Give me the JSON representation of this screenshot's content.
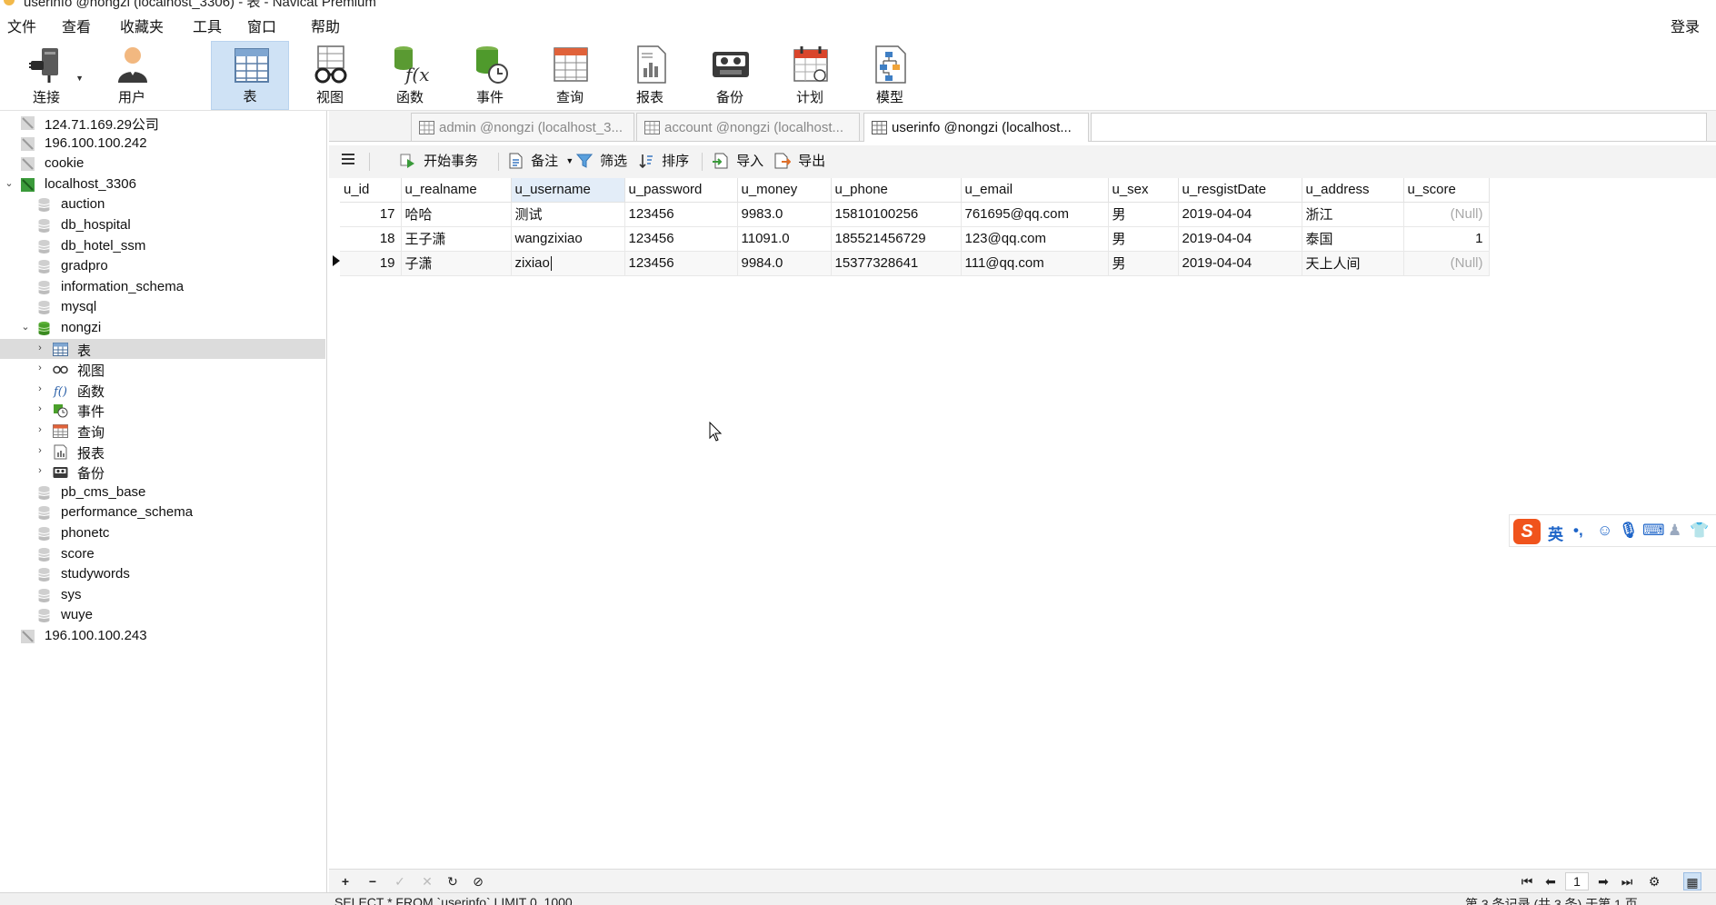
{
  "window": {
    "title": "userinfo @nongzi (localhost_3306) - 表 - Navicat Premium"
  },
  "menubar": {
    "items": [
      "文件",
      "查看",
      "收藏夹",
      "工具",
      "窗口",
      "帮助"
    ],
    "login": "登录"
  },
  "toolbar": {
    "connect": "连接",
    "user": "用户",
    "table": "表",
    "view": "视图",
    "function": "函数",
    "event": "事件",
    "query": "查询",
    "report": "报表",
    "backup": "备份",
    "schedule": "计划",
    "model": "模型"
  },
  "tree": {
    "items": [
      {
        "label": "124.71.169.29公司",
        "level": 0,
        "type": "server-off"
      },
      {
        "label": "196.100.100.242",
        "level": 0,
        "type": "server-off"
      },
      {
        "label": "cookie",
        "level": 0,
        "type": "server-off"
      },
      {
        "label": "localhost_3306",
        "level": 0,
        "type": "server-on",
        "expanded": true
      },
      {
        "label": "auction",
        "level": 1,
        "type": "db"
      },
      {
        "label": "db_hospital",
        "level": 1,
        "type": "db"
      },
      {
        "label": "db_hotel_ssm",
        "level": 1,
        "type": "db"
      },
      {
        "label": "gradpro",
        "level": 1,
        "type": "db"
      },
      {
        "label": "information_schema",
        "level": 1,
        "type": "db"
      },
      {
        "label": "mysql",
        "level": 1,
        "type": "db"
      },
      {
        "label": "nongzi",
        "level": 1,
        "type": "db-open",
        "expanded": true
      },
      {
        "label": "表",
        "level": 2,
        "type": "tables",
        "selected": true
      },
      {
        "label": "视图",
        "level": 2,
        "type": "views"
      },
      {
        "label": "函数",
        "level": 2,
        "type": "functions"
      },
      {
        "label": "事件",
        "level": 2,
        "type": "events"
      },
      {
        "label": "查询",
        "level": 2,
        "type": "queries"
      },
      {
        "label": "报表",
        "level": 2,
        "type": "reports"
      },
      {
        "label": "备份",
        "level": 2,
        "type": "backups"
      },
      {
        "label": "pb_cms_base",
        "level": 1,
        "type": "db"
      },
      {
        "label": "performance_schema",
        "level": 1,
        "type": "db"
      },
      {
        "label": "phonetc",
        "level": 1,
        "type": "db"
      },
      {
        "label": "score",
        "level": 1,
        "type": "db"
      },
      {
        "label": "studywords",
        "level": 1,
        "type": "db"
      },
      {
        "label": "sys",
        "level": 1,
        "type": "db"
      },
      {
        "label": "wuye",
        "level": 1,
        "type": "db"
      },
      {
        "label": "196.100.100.243",
        "level": 0,
        "type": "server-off"
      }
    ]
  },
  "tabs": [
    {
      "label": "admin @nongzi (localhost_3...",
      "active": false
    },
    {
      "label": "account @nongzi (localhost...",
      "active": false
    },
    {
      "label": "userinfo @nongzi (localhost...",
      "active": true
    }
  ],
  "gridtools": {
    "begin_transaction": "开始事务",
    "note": "备注",
    "filter": "筛选",
    "sort": "排序",
    "import": "导入",
    "export": "导出"
  },
  "table": {
    "columns": [
      "u_id",
      "u_realname",
      "u_username",
      "u_password",
      "u_money",
      "u_phone",
      "u_email",
      "u_sex",
      "u_resgistDate",
      "u_address",
      "u_score"
    ],
    "rows": [
      [
        "17",
        "哈哈",
        "测试",
        "123456",
        "9983.0",
        "15810100256",
        "761695@qq.com",
        "男",
        "2019-04-04",
        "浙江",
        "(Null)"
      ],
      [
        "18",
        "王子潇",
        "wangzixiao",
        "123456",
        "11091.0",
        "185521456729",
        "123@qq.com",
        "男",
        "2019-04-04",
        "泰国",
        "1"
      ],
      [
        "19",
        "子潇",
        "zixiao",
        "123456",
        "9984.0",
        "15377328641",
        "111@qq.com",
        "男",
        "2019-04-04",
        "天上人间",
        "(Null)"
      ]
    ]
  },
  "gridnav": {
    "page": "1"
  },
  "statusbar": {
    "sql": "SELECT * FROM `userinfo` LIMIT 0, 1000",
    "records": "第 3 条记录 (共 3 条) 于第 1 页"
  },
  "ime": {
    "lang": "英"
  }
}
